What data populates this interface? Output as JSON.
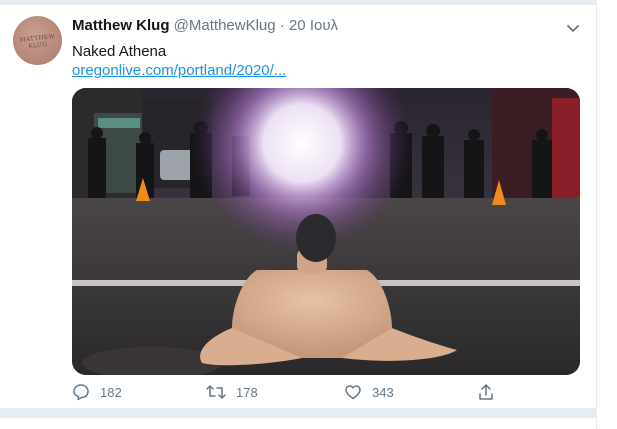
{
  "tweet": {
    "author_name": "Matthew Klug",
    "handle": "@MatthewKlug",
    "separator": "·",
    "date": "20 Ιουλ",
    "text": "Naked Athena",
    "link": "oregonlive.com/portland/2020/...",
    "avatar_text": "MATTHEW KLUG",
    "media": {
      "description_icon": "photo"
    }
  },
  "actions": {
    "reply_count": "182",
    "retweet_count": "178",
    "like_count": "343"
  },
  "colors": {
    "text_primary": "#14171a",
    "text_secondary": "#657786",
    "link": "#1b95e0",
    "divider": "#e6ecf0"
  }
}
